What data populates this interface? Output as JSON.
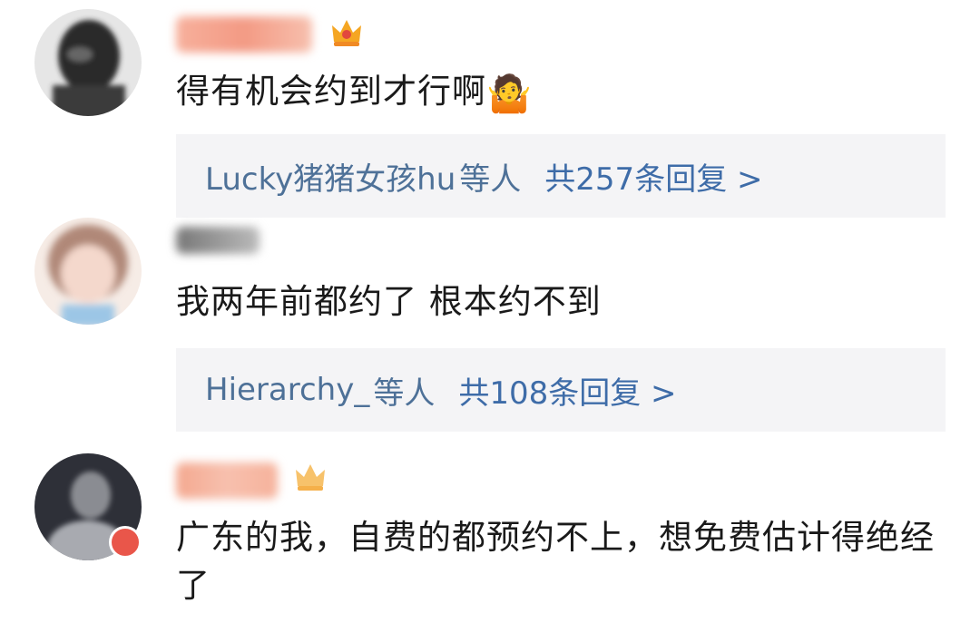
{
  "comments": [
    {
      "text": "得有机会约到才行啊",
      "emoji": "🤷",
      "replies": {
        "users": "Lucky猪猪女孩hu",
        "suffix": "等人",
        "total": "共257条回复 >"
      }
    },
    {
      "text": "我两年前都约了 根本约不到",
      "replies": {
        "users": "Hierarchy_",
        "suffix": "等人",
        "total": "共108条回复 >"
      }
    },
    {
      "text": "广东的我，自费的都预约不上，想免费估计得绝经了"
    }
  ],
  "colors": {
    "reply_link": "#3e6ca8",
    "reply_bg": "#f4f4f6",
    "username_blur": "#f6b29b"
  }
}
